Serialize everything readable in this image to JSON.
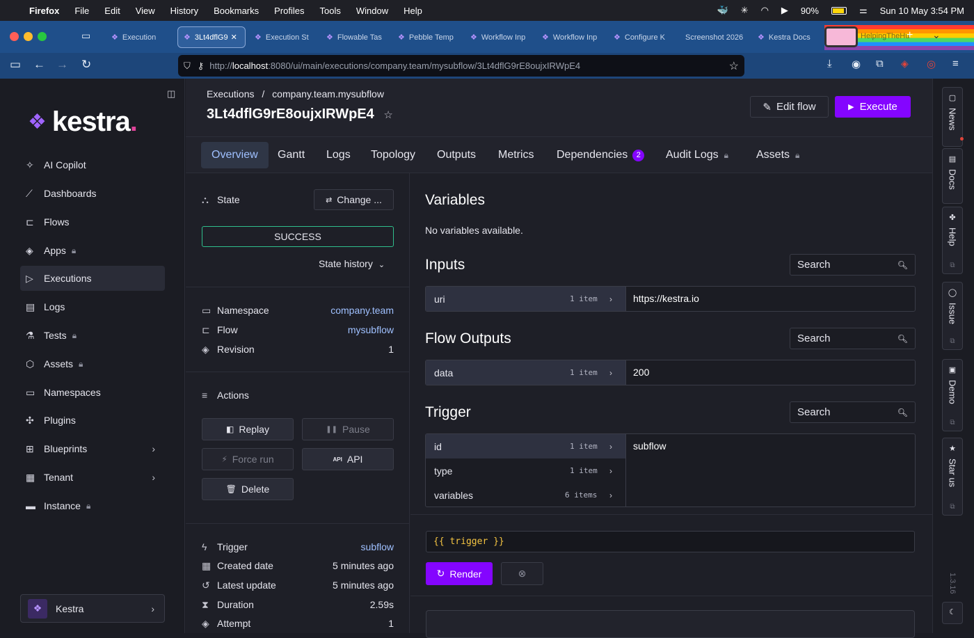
{
  "menubar": {
    "app": "Firefox",
    "items": [
      "File",
      "Edit",
      "View",
      "History",
      "Bookmarks",
      "Profiles",
      "Tools",
      "Window",
      "Help"
    ],
    "battery": "90%",
    "clock": "Sun 10 May  3:54 PM"
  },
  "browser": {
    "tabs": [
      "Execution",
      "3Lt4dflG9",
      "Execution St",
      "Flowable Tas",
      "Pebble Temp",
      "Workflow Inp",
      "Workflow Inp",
      "Configure K",
      "Screenshot 2026",
      "Kestra Docs",
      "HelpingTheHu"
    ],
    "url_prefix": "http://",
    "url_host": "localhost",
    "url_path": ":8080/ui/main/executions/company.team/mysubflow/3Lt4dflG9rE8oujxIRWpE4"
  },
  "sidebar": {
    "logo": "kestra",
    "items": [
      {
        "label": "AI Copilot",
        "icon": "sparkle-icon"
      },
      {
        "label": "Dashboards",
        "icon": "chart-line-icon"
      },
      {
        "label": "Flows",
        "icon": "flow-icon"
      },
      {
        "label": "Apps",
        "icon": "layers-icon",
        "locked": true
      },
      {
        "label": "Executions",
        "icon": "play-icon",
        "active": true
      },
      {
        "label": "Logs",
        "icon": "file-icon"
      },
      {
        "label": "Tests",
        "icon": "flask-icon",
        "locked": true
      },
      {
        "label": "Assets",
        "icon": "cube-icon",
        "locked": true
      },
      {
        "label": "Namespaces",
        "icon": "folder-icon"
      },
      {
        "label": "Plugins",
        "icon": "puzzle-icon"
      },
      {
        "label": "Blueprints",
        "icon": "blueprint-icon"
      },
      {
        "label": "Tenant",
        "icon": "building-icon"
      },
      {
        "label": "Instance",
        "icon": "server-icon",
        "locked": true
      }
    ],
    "tenant": "Kestra"
  },
  "header": {
    "breadcrumb_root": "Executions",
    "breadcrumb_sep": "/",
    "breadcrumb_flow": "company.team.mysubflow",
    "execution_id": "3Lt4dflG9rE8oujxIRWpE4",
    "edit_label": "Edit flow",
    "execute_label": "Execute"
  },
  "tabs": {
    "overview": "Overview",
    "gantt": "Gantt",
    "logs": "Logs",
    "topology": "Topology",
    "outputs": "Outputs",
    "metrics": "Metrics",
    "dependencies": "Dependencies",
    "dependencies_count": "2",
    "audit": "Audit Logs",
    "assets": "Assets"
  },
  "overview": {
    "state_label": "State",
    "change_label": "Change ...",
    "state_value": "SUCCESS",
    "state_history": "State history",
    "namespace_label": "Namespace",
    "namespace_value": "company.team",
    "flow_label": "Flow",
    "flow_value": "mysubflow",
    "revision_label": "Revision",
    "revision_value": "1",
    "actions_label": "Actions",
    "replay": "Replay",
    "pause": "Pause",
    "force_run": "Force run",
    "api": "API",
    "delete": "Delete",
    "trigger_label": "Trigger",
    "trigger_value": "subflow",
    "created_label": "Created date",
    "created_value": "5 minutes ago",
    "updated_label": "Latest update",
    "updated_value": "5 minutes ago",
    "duration_label": "Duration",
    "duration_value": "2.59s",
    "attempt_label": "Attempt",
    "attempt_value": "1"
  },
  "details": {
    "variables_title": "Variables",
    "variables_empty": "No variables available.",
    "inputs_title": "Inputs",
    "search": "Search",
    "inputs": [
      {
        "key": "uri",
        "count": "1 item",
        "value": "https://kestra.io"
      }
    ],
    "outputs_title": "Flow Outputs",
    "outputs": [
      {
        "key": "data",
        "count": "1 item",
        "value": "200"
      }
    ],
    "trigger_title": "Trigger",
    "trigger": [
      {
        "key": "id",
        "count": "1 item"
      },
      {
        "key": "type",
        "count": "1 item"
      },
      {
        "key": "variables",
        "count": "6 items"
      }
    ],
    "trigger_selected_value": "subflow",
    "expression": "{{ trigger }}",
    "render": "Render"
  },
  "rail": {
    "items": [
      "News",
      "Docs",
      "Help",
      "Issue",
      "Demo",
      "Star us"
    ],
    "version": "1.3.16"
  }
}
